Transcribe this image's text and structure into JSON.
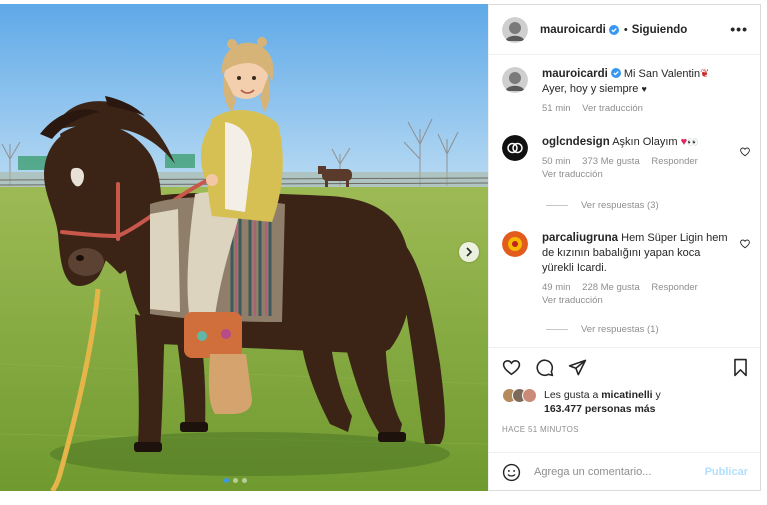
{
  "post": {
    "username": "mauroicardi",
    "follow_status": "Siguiendo",
    "more_label": "•••"
  },
  "caption": {
    "username": "mauroicardi",
    "text": "Mi San Valentin",
    "line2": "Ayer, hoy y siempre",
    "time": "51 min",
    "translate": "Ver traducción"
  },
  "comments": [
    {
      "username": "oglcndesign",
      "text": "Aşkın Olayım",
      "time": "50 min",
      "likes": "373 Me gusta",
      "reply": "Responder",
      "translate": "Ver traducción",
      "view_replies": "Ver respuestas (3)"
    },
    {
      "username": "parcaliugruna",
      "text": "Hem Süper Ligin hem de kızının babalığını yapan koca yürekli Icardi.",
      "time": "49 min",
      "likes": "228 Me gusta",
      "reply": "Responder",
      "translate": "Ver traducción",
      "view_replies": "Ver respuestas (1)"
    }
  ],
  "likes": {
    "prefix": "Les gusta a",
    "user": "micatinelli",
    "conj": "y",
    "others": "163.477 personas más"
  },
  "timestamp": "HACE 51 MINUTOS",
  "composer": {
    "placeholder": "Agrega un comentario...",
    "publish": "Publicar"
  },
  "colors": {
    "link_blue": "#b2dffc",
    "verified_blue": "#3897f0",
    "heart_red": "#ed4956"
  },
  "icons": [
    "chevron-right-icon",
    "heart-icon",
    "comment-icon",
    "share-icon",
    "bookmark-icon",
    "emoji-icon",
    "verified-icon",
    "more-icon"
  ]
}
